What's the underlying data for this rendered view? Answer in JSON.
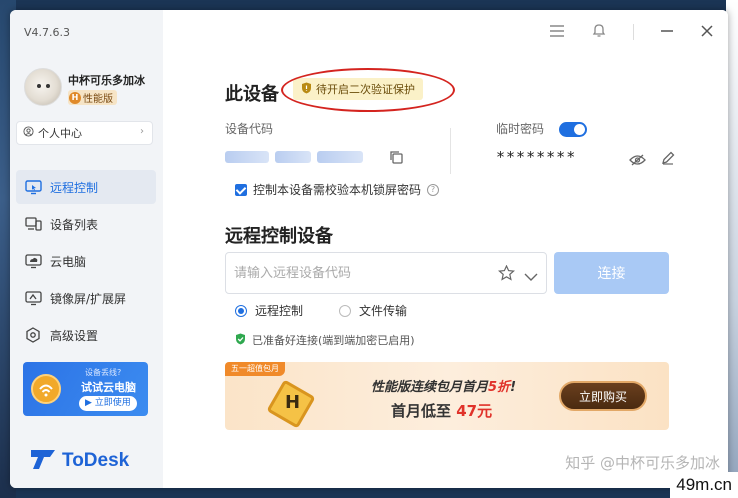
{
  "sidebar": {
    "version": "V4.7.6.3",
    "user": {
      "name": "中杯可乐多加冰",
      "tier": "性能版",
      "tier_badge": "H"
    },
    "personal_center": "个人中心",
    "nav": [
      {
        "label": "远程控制",
        "icon": "remote-control-icon",
        "active": true
      },
      {
        "label": "设备列表",
        "icon": "device-list-icon",
        "active": false
      },
      {
        "label": "云电脑",
        "icon": "cloud-pc-icon",
        "active": false
      },
      {
        "label": "镜像屏/扩展屏",
        "icon": "mirror-screen-icon",
        "active": false
      },
      {
        "label": "高级设置",
        "icon": "settings-icon",
        "active": false
      }
    ],
    "promo": {
      "line1": "设备丢线?",
      "line2": "试试云电脑",
      "cta": "立即使用"
    },
    "logo": "ToDesk"
  },
  "main": {
    "device_title": "此设备",
    "security_badge": "待开启二次验证保护",
    "device_code_label": "设备代码",
    "temp_password_label": "临时密码",
    "temp_password_enabled": true,
    "temp_password_value": "********",
    "lock_check_label": "控制本设备需校验本机锁屏密码",
    "remote_title": "远程控制设备",
    "remote_input_placeholder": "请输入远程设备代码",
    "connect_label": "连接",
    "modes": [
      {
        "label": "远程控制",
        "selected": true
      },
      {
        "label": "文件传输",
        "selected": false
      }
    ],
    "status_text": "已准备好连接(端到端加密已启用)",
    "banner": {
      "tag": "五一超值包月",
      "badge_letter": "H",
      "line1_prefix": "性能版连续包月首月",
      "line1_highlight": "5折",
      "line1_suffix": "!",
      "line2_prefix": "首月低至",
      "line2_highlight": "47元",
      "buy_label": "立即购买"
    }
  },
  "watermark": {
    "zhihu": "知乎 @中杯可乐多加冰",
    "site": "49m.cn"
  },
  "colors": {
    "accent": "#1f6fe0",
    "annotation": "#d4241f",
    "promo_red": "#e0322a"
  }
}
